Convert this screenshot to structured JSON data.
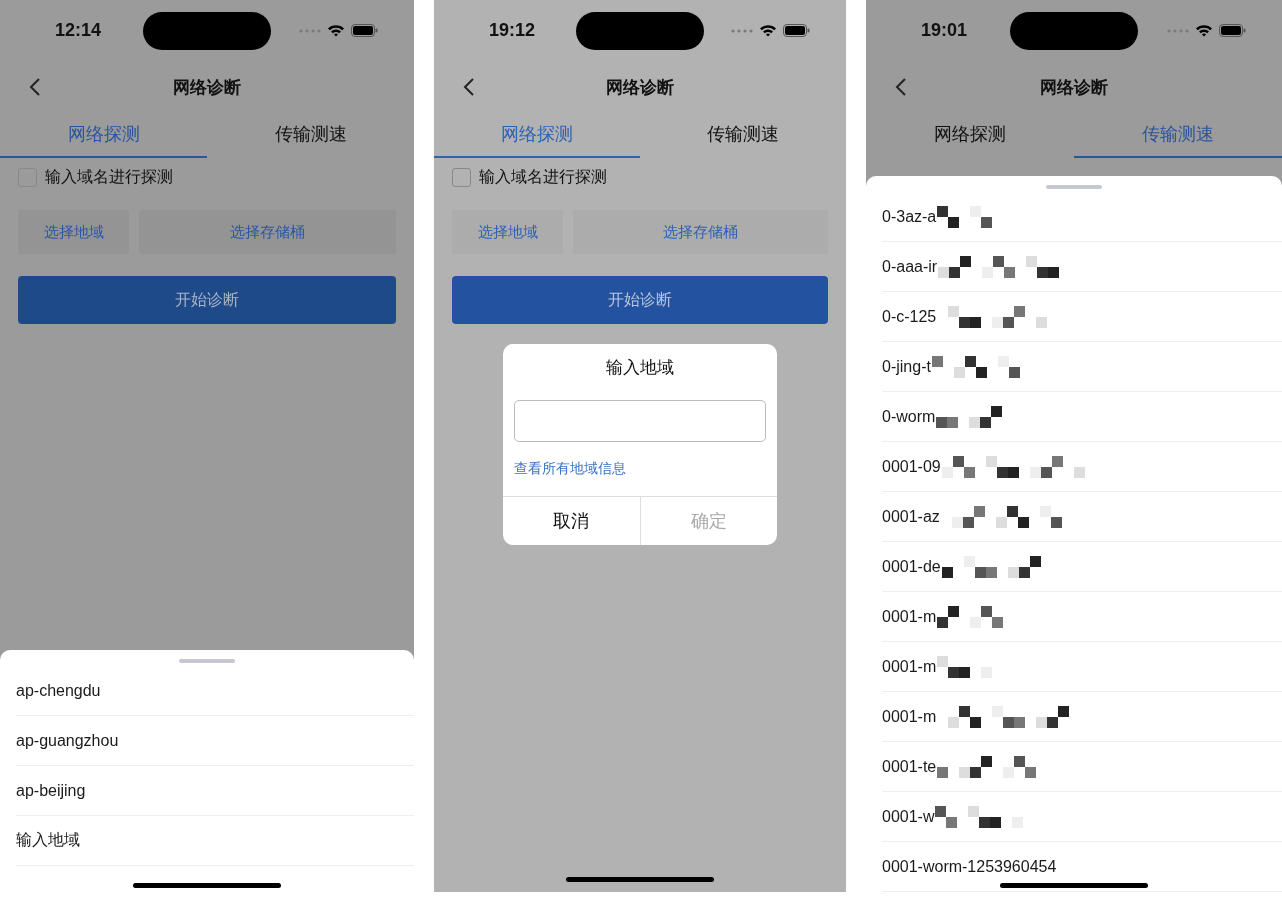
{
  "phones": [
    {
      "status_bar": {
        "time": "12:14"
      },
      "nav_bar": {
        "title": "网络诊断"
      },
      "tabs": [
        {
          "label": "网络探测",
          "selected": true
        },
        {
          "label": "传输测速",
          "selected": false
        }
      ],
      "checkbox": {
        "label": "输入域名进行探测",
        "checked": false
      },
      "region_button": "选择地域",
      "bucket_button": "选择存储桶",
      "start_button": "开始诊断",
      "overlay": {
        "kind": "sheet",
        "items": [
          {
            "label": "ap-chengdu",
            "redacted": false
          },
          {
            "label": "ap-guangzhou",
            "redacted": false
          },
          {
            "label": "ap-beijing",
            "redacted": false
          },
          {
            "label": "输入地域",
            "redacted": false
          }
        ]
      }
    },
    {
      "status_bar": {
        "time": "19:12"
      },
      "nav_bar": {
        "title": "网络诊断"
      },
      "tabs": [
        {
          "label": "网络探测",
          "selected": true
        },
        {
          "label": "传输测速",
          "selected": false
        }
      ],
      "checkbox": {
        "label": "输入域名进行探测",
        "checked": false
      },
      "region_button": "选择地域",
      "bucket_button": "选择存储桶",
      "start_button": "开始诊断",
      "overlay": {
        "kind": "dialog",
        "title": "输入地域",
        "link": "查看所有地域信息",
        "buttons": [
          {
            "label": "取消",
            "disabled": false
          },
          {
            "label": "确定",
            "disabled": true
          }
        ]
      }
    },
    {
      "status_bar": {
        "time": "19:01"
      },
      "nav_bar": {
        "title": "网络诊断"
      },
      "tabs": [
        {
          "label": "网络探测",
          "selected": false
        },
        {
          "label": "传输测速",
          "selected": true
        }
      ],
      "overlay": {
        "kind": "sheet",
        "items": [
          {
            "label": "0-3az-a",
            "redacted": true
          },
          {
            "label": "0-aaa-ir",
            "redacted": true
          },
          {
            "label": "0-c-125",
            "redacted": true
          },
          {
            "label": "0-jing-t",
            "redacted": true
          },
          {
            "label": "0-worm",
            "redacted": true
          },
          {
            "label": "0001-09",
            "redacted": true
          },
          {
            "label": "0001-az",
            "redacted": true
          },
          {
            "label": "0001-de",
            "redacted": true
          },
          {
            "label": "0001-m",
            "redacted": true
          },
          {
            "label": "0001-m",
            "redacted": true
          },
          {
            "label": "0001-m",
            "redacted": true
          },
          {
            "label": "0001-te",
            "redacted": true
          },
          {
            "label": "0001-w",
            "redacted": true
          },
          {
            "label": "0001-worm-1253960454",
            "redacted": false
          }
        ]
      }
    }
  ]
}
